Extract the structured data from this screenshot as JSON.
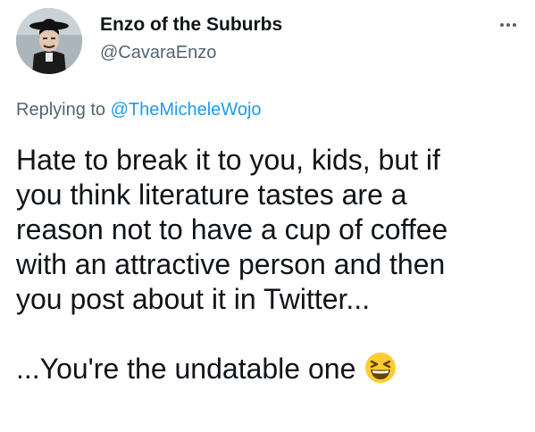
{
  "author": {
    "display_name": "Enzo of the Suburbs",
    "handle": "@CavaraEnzo",
    "avatar_icon": "avatar-photo"
  },
  "more_icon": "more-dots-icon",
  "reply": {
    "prefix": "Replying to",
    "mention": "@TheMicheleWojo"
  },
  "tweet": {
    "lines": [
      "Hate to break it to you, kids, but if",
      "you think literature tastes are a",
      "reason not to have a cup of coffee",
      "with an attractive person and then",
      "you post about it in Twitter..."
    ],
    "last_line": "...You're the undatable one",
    "emoji_icon": "grinning-squinting-face-icon"
  },
  "colors": {
    "text": "#0f1419",
    "secondary": "#536471",
    "link": "#1d9bf0",
    "emoji": "#ffcc33"
  }
}
